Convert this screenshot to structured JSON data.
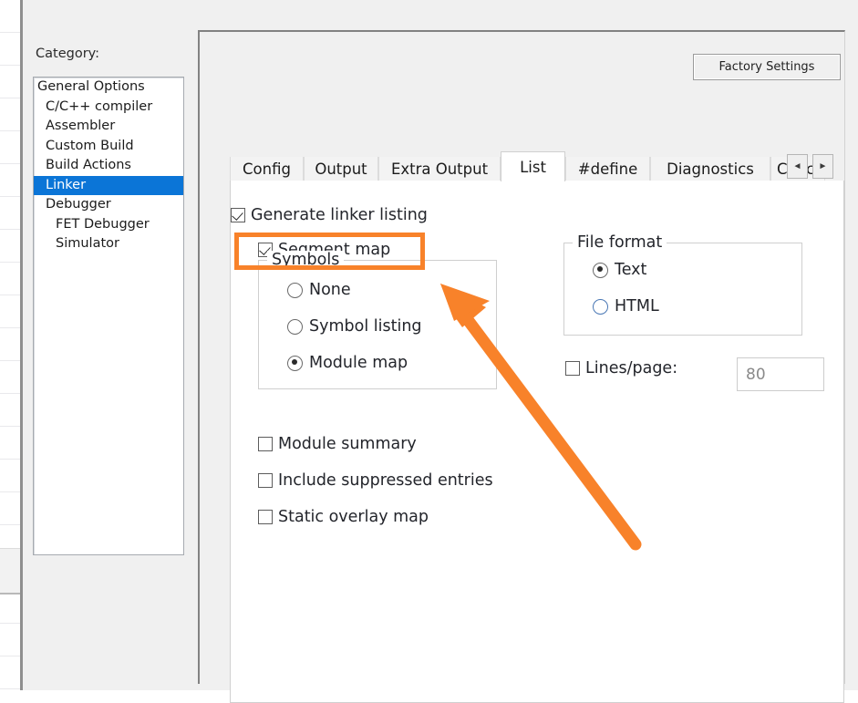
{
  "dialog": {
    "category_label": "Category:",
    "categories": [
      {
        "label": "General Options",
        "indent": 0,
        "selected": false
      },
      {
        "label": "C/C++ compiler",
        "indent": 1,
        "selected": false
      },
      {
        "label": "Assembler",
        "indent": 1,
        "selected": false
      },
      {
        "label": "Custom Build",
        "indent": 1,
        "selected": false
      },
      {
        "label": "Build Actions",
        "indent": 1,
        "selected": false
      },
      {
        "label": "Linker",
        "indent": 1,
        "selected": true
      },
      {
        "label": "Debugger",
        "indent": 1,
        "selected": false
      },
      {
        "label": "FET Debugger",
        "indent": 2,
        "selected": false
      },
      {
        "label": "Simulator",
        "indent": 2,
        "selected": false
      }
    ],
    "factory_settings_label": "Factory Settings"
  },
  "tabs": {
    "items": [
      {
        "label": "Config",
        "active": false
      },
      {
        "label": "Output",
        "active": false
      },
      {
        "label": "Extra Output",
        "active": false
      },
      {
        "label": "List",
        "active": true
      },
      {
        "label": "#define",
        "active": false
      },
      {
        "label": "Diagnostics",
        "active": false
      },
      {
        "label": "Chec",
        "active": false
      }
    ],
    "nav_prev": "◄",
    "nav_next": "►"
  },
  "list_page": {
    "generate_linker_listing": {
      "label": "Generate linker listing",
      "checked": true
    },
    "segment_map": {
      "label": "Segment map",
      "checked": true
    },
    "symbols_group": {
      "title": "Symbols",
      "options": [
        {
          "label": "None",
          "selected": false
        },
        {
          "label": "Symbol listing",
          "selected": false
        },
        {
          "label": "Module map",
          "selected": true
        }
      ]
    },
    "extra_checkboxes": [
      {
        "label": "Module summary",
        "checked": false
      },
      {
        "label": "Include suppressed entries",
        "checked": false
      },
      {
        "label": "Static overlay map",
        "checked": false
      }
    ],
    "file_format_group": {
      "title": "File format",
      "options": [
        {
          "label": "Text",
          "selected": true
        },
        {
          "label": "HTML",
          "selected": false
        }
      ]
    },
    "lines_per_page": {
      "label": "Lines/page:",
      "checked": false,
      "value": "80"
    }
  },
  "annotations": {
    "highlight_color": "#f8822a",
    "arrow_color": "#f8822a",
    "highlight_target": "segment-map-checkbox",
    "arrow_points_to": "segment-map-checkbox"
  },
  "colors": {
    "selection_blue": "#0b75d7",
    "dialog_bg": "#f0f0f0",
    "panel_white": "#ffffff"
  }
}
